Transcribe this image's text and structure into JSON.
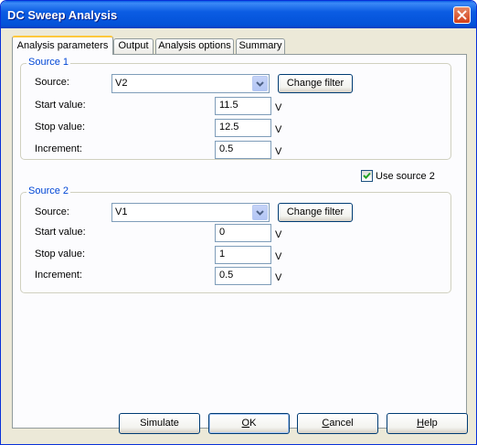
{
  "window": {
    "title": "DC Sweep Analysis"
  },
  "tabs": [
    {
      "label": "Analysis parameters",
      "active": true
    },
    {
      "label": "Output",
      "active": false
    },
    {
      "label": "Analysis options",
      "active": false
    },
    {
      "label": "Summary",
      "active": false
    }
  ],
  "source1": {
    "legend": "Source 1",
    "source_label": "Source:",
    "source_value": "V2",
    "change_filter": "Change filter",
    "start_label": "Start value:",
    "start_value": "11.5",
    "stop_label": "Stop value:",
    "stop_value": "12.5",
    "increment_label": "Increment:",
    "increment_value": "0.5",
    "unit": "V"
  },
  "use_source2": {
    "label": "Use source 2",
    "checked": true
  },
  "source2": {
    "legend": "Source 2",
    "source_label": "Source:",
    "source_value": "V1",
    "change_filter": "Change filter",
    "start_label": "Start value:",
    "start_value": "0",
    "stop_label": "Stop value:",
    "stop_value": "1",
    "increment_label": "Increment:",
    "increment_value": "0.5",
    "unit": "V"
  },
  "buttons": {
    "simulate": "Simulate",
    "ok_mnemonic": "O",
    "ok_rest": "K",
    "cancel_mnemonic": "C",
    "cancel_rest": "ancel",
    "help_mnemonic": "H",
    "help_rest": "elp"
  }
}
